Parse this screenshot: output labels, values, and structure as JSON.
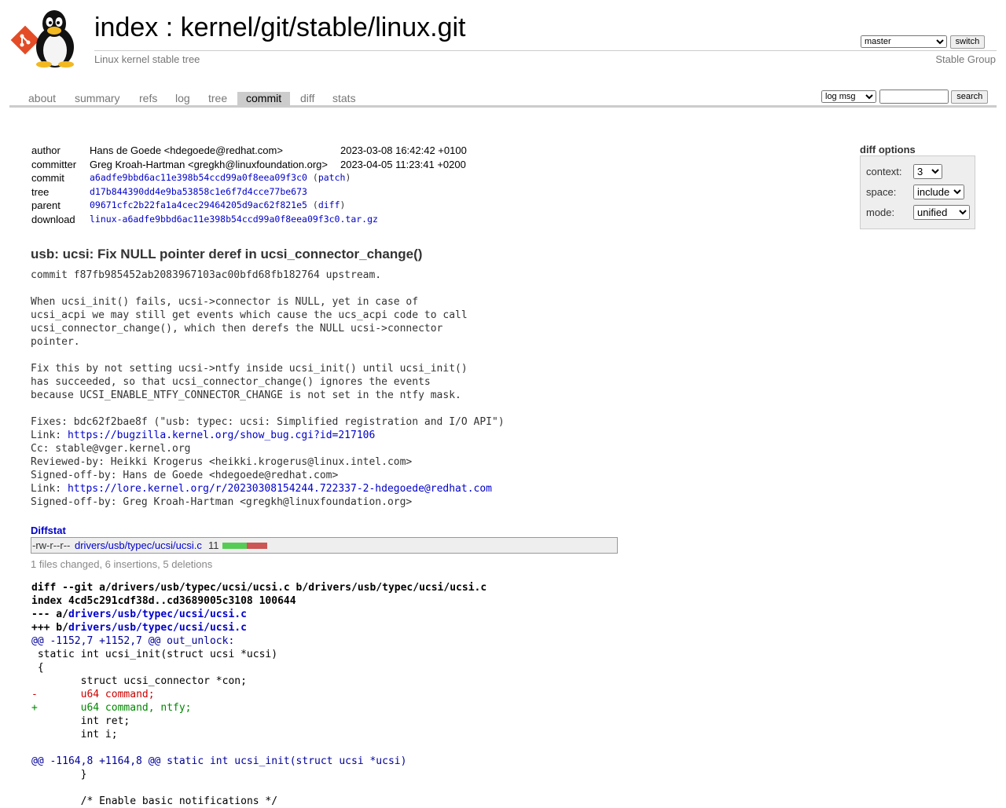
{
  "header": {
    "title_index": "index",
    "title_sep": " : ",
    "title_repo": "kernel/git/stable/linux.git",
    "description": "Linux kernel stable tree",
    "branch": "master",
    "switch_label": "switch",
    "group": "Stable Group"
  },
  "tabs": [
    "about",
    "summary",
    "refs",
    "log",
    "tree",
    "commit",
    "diff",
    "stats"
  ],
  "active_tab": "commit",
  "search": {
    "mode": "log msg",
    "query": "",
    "button": "search"
  },
  "commit_info": {
    "author_label": "author",
    "author": "Hans de Goede <hdegoede@redhat.com>",
    "author_date": "2023-03-08 16:42:42 +0100",
    "committer_label": "committer",
    "committer": "Greg Kroah-Hartman <gregkh@linuxfoundation.org>",
    "committer_date": "2023-04-05 11:23:41 +0200",
    "commit_label": "commit",
    "commit": "a6adfe9bbd6ac11e398b54ccd99a0f8eea09f3c0",
    "patch_link": "patch",
    "tree_label": "tree",
    "tree": "d17b844390dd4e9ba53858c1e6f7d4cce77be673",
    "parent_label": "parent",
    "parent": "09671cfc2b22fa1a4cec29464205d9ac62f821e5",
    "diff_link": "diff",
    "download_label": "download",
    "download": "linux-a6adfe9bbd6ac11e398b54ccd99a0f8eea09f3c0.tar.gz"
  },
  "diff_options": {
    "title": "diff options",
    "context_label": "context:",
    "context": "3",
    "space_label": "space:",
    "space": "include",
    "mode_label": "mode:",
    "mode": "unified"
  },
  "subject": "usb: ucsi: Fix NULL pointer deref in ucsi_connector_change()",
  "message": {
    "line1": "commit f87fb985452ab2083967103ac00bfd68fb182764 upstream.",
    "para1": "When ucsi_init() fails, ucsi->connector is NULL, yet in case of\nucsi_acpi we may still get events which cause the ucs_acpi code to call\nucsi_connector_change(), which then derefs the NULL ucsi->connector\npointer.",
    "para2": "Fix this by not setting ucsi->ntfy inside ucsi_init() until ucsi_init()\nhas succeeded, so that ucsi_connector_change() ignores the events\nbecause UCSI_ENABLE_NTFY_CONNECTOR_CHANGE is not set in the ntfy mask.",
    "fixes": "Fixes: bdc62f2bae8f (\"usb: typec: ucsi: Simplified registration and I/O API\")",
    "link1_prefix": "Link: ",
    "link1": "https://bugzilla.kernel.org/show_bug.cgi?id=217106",
    "tags_mid": "Cc: stable@vger.kernel.org\nReviewed-by: Heikki Krogerus <heikki.krogerus@linux.intel.com>\nSigned-off-by: Hans de Goede <hdegoede@redhat.com>",
    "link2_prefix": "Link: ",
    "link2": "https://lore.kernel.org/r/20230308154244.722337-2-hdegoede@redhat.com",
    "tags_end": "Signed-off-by: Greg Kroah-Hartman <gregkh@linuxfoundation.org>"
  },
  "diffstat": {
    "title": "Diffstat",
    "mode": "-rw-r--r--",
    "file": "drivers/usb/typec/ucsi/ucsi.c",
    "count": "11",
    "insertions": 6,
    "deletions": 5,
    "summary": "1 files changed, 6 insertions, 5 deletions"
  },
  "diff": {
    "head1": "diff --git a/drivers/usb/typec/ucsi/ucsi.c b/drivers/usb/typec/ucsi/ucsi.c",
    "head2": "index 4cd5c291cdf38d..cd3689005c3108 100644",
    "minus_prefix": "--- a/",
    "plus_prefix": "+++ b/",
    "file_path": "drivers/usb/typec/ucsi/ucsi.c",
    "hunk1": "@@ -1152,7 +1152,7 @@ out_unlock:",
    "ctx1": " static int ucsi_init(struct ucsi *ucsi)",
    "ctx2": " {",
    "ctx3": " \tstruct ucsi_connector *con;",
    "del1": "-\tu64 command;",
    "add1": "+\tu64 command, ntfy;",
    "ctx4": " \tint ret;",
    "ctx5": " \tint i;",
    "ctx6": "",
    "hunk2": "@@ -1164,8 +1164,8 @@ static int ucsi_init(struct ucsi *ucsi)",
    "ctx7": " \t}",
    "ctx8": "",
    "ctx9": " \t/* Enable basic notifications */"
  }
}
